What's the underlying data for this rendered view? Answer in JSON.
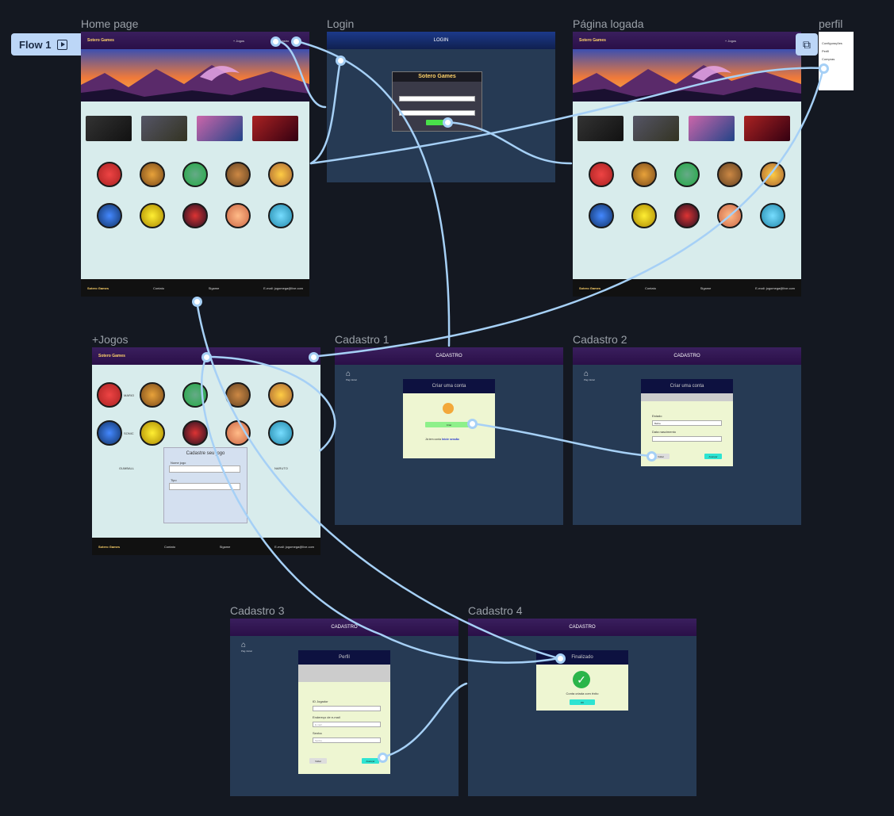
{
  "flow": {
    "label": "Flow 1"
  },
  "frames": {
    "home": {
      "title": "Home page"
    },
    "login": {
      "title": "Login",
      "bar": "LOGIN",
      "card_title": "Sotero Games"
    },
    "logged": {
      "title": "Página logada"
    },
    "perfil": {
      "title": "perfil",
      "items": [
        "Configurações",
        "Perfil",
        "Compras"
      ]
    },
    "jogos": {
      "title": "+Jogos",
      "modal_title": "Cadastre seu jogo",
      "name_label": "Nome jogo",
      "type_label": "Tipo",
      "labels": [
        "MARIO",
        "SONIC",
        "GUMBALL",
        "NARUTO"
      ]
    },
    "cad1": {
      "title": "Cadastro 1",
      "bar": "CADASTRO",
      "modal_title": "Criar uma conta",
      "btn": "Criar",
      "hint": "Já tem conta",
      "link": "Inicie sessão"
    },
    "cad2": {
      "title": "Cadastro 2",
      "bar": "CADASTRO",
      "modal_title": "Criar uma conta",
      "state_label": "Estado",
      "state_value": "Bahia",
      "date_label": "Data nascimento",
      "back": "Voltar",
      "next": "Avançar"
    },
    "cad3": {
      "title": "Cadastro 3",
      "bar": "CADASTRO",
      "modal_title": "Perfil",
      "id_label": "ID Jogador",
      "email_label": "Endereço de e-mail",
      "email_ph": "E-mail",
      "pass_label": "Senha",
      "pass_ph": "Senha",
      "back": "Voltar",
      "next": "Avançar"
    },
    "cad4": {
      "title": "Cadastro 4",
      "bar": "CADASTRO",
      "modal_title": "Finalizado",
      "msg": "Conta criada com êxito",
      "ok": "OK"
    }
  },
  "site": {
    "logo": "Sotero Games",
    "menu_jogos": "+ Jogos",
    "menu_cadastro": "Cadastro",
    "footer_contato": "Contato",
    "footer_fb": "Sigame",
    "footer_email": "E-mail: jogomega@live.com"
  },
  "nav_home": "Pág inicial",
  "colors": {
    "accent": "#a6d0f6",
    "canvas": "#141821",
    "frame_navy": "#263a54",
    "page_bg": "#d8ecec",
    "modal_bg": "#eef6d2"
  }
}
